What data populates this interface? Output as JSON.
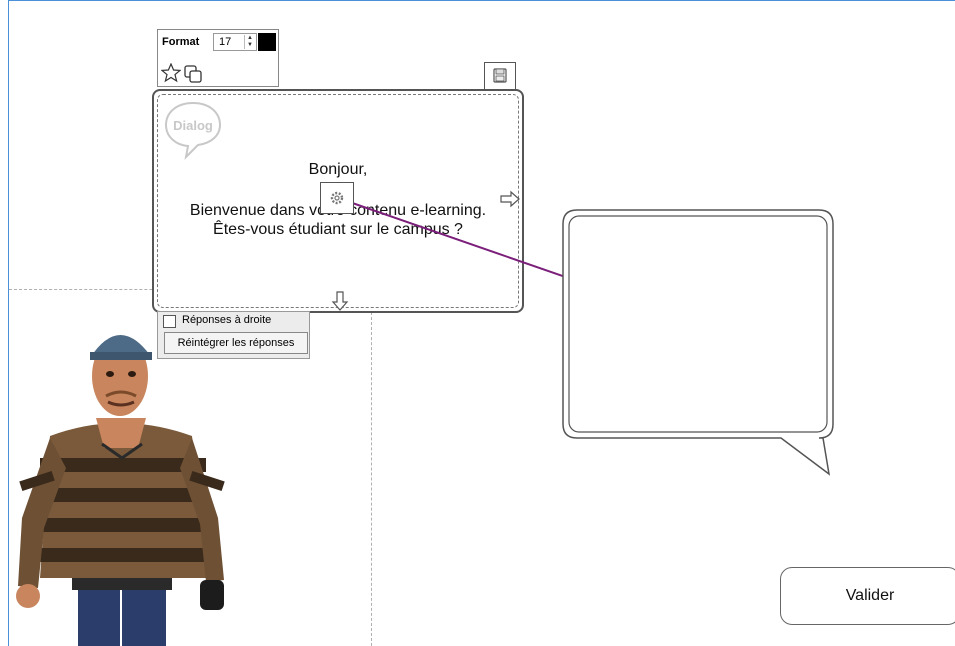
{
  "format_bar": {
    "label": "Format",
    "font_size": "17",
    "color": "#000000"
  },
  "dialog": {
    "icon_text": "Dialog",
    "line1": "Bonjour,",
    "line2": "Bienvenue dans votre contenu e-learning.",
    "line3": "Êtes-vous étudiant sur le campus ?"
  },
  "responses_panel": {
    "checkbox_label": "Réponses à droite",
    "button_label": "Réintégrer les réponses"
  },
  "valider_label": "Valider",
  "colors": {
    "link_line": "#7b1f7b",
    "frame": "#4a90d9"
  }
}
